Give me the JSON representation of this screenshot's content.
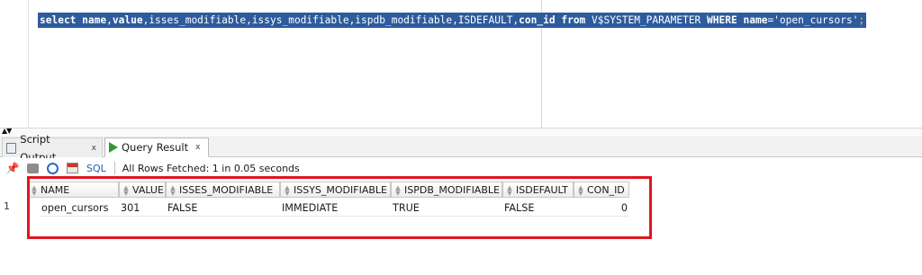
{
  "editor": {
    "sql_keyword_select": "select",
    "sql_col_name": "name",
    "sql_col_value": "value",
    "sql_rest_cols": ",isses_modifiable,issys_modifiable,ispdb_modifiable,ISDEFAULT,",
    "sql_col_con_id": "con_id",
    "sql_keyword_from": "from",
    "sql_table": "V$SYSTEM_PARAMETER",
    "sql_keyword_where": "WHERE",
    "sql_where_col": "name",
    "sql_where_val": "='open_cursors'",
    "sql_semicolon": ";"
  },
  "tabs": [
    {
      "label": "Script Output",
      "close": "x",
      "icon": "script-icon"
    },
    {
      "label": "Query Result",
      "close": "x",
      "icon": "play-icon"
    }
  ],
  "toolbar": {
    "sql_label": "SQL",
    "status": "All Rows Fetched: 1 in 0.05 seconds"
  },
  "grid": {
    "columns": [
      "NAME",
      "VALUE",
      "ISSES_MODIFIABLE",
      "ISSYS_MODIFIABLE",
      "ISPDB_MODIFIABLE",
      "ISDEFAULT",
      "CON_ID"
    ],
    "rows": [
      {
        "num": "1",
        "cells": [
          "open_cursors",
          "301",
          "FALSE",
          "IMMEDIATE",
          "TRUE",
          "FALSE",
          "0"
        ]
      }
    ]
  },
  "colors": {
    "selection": "#2d5b9e",
    "highlight_box": "#e0151f",
    "sql_link": "#1f5fb4"
  }
}
